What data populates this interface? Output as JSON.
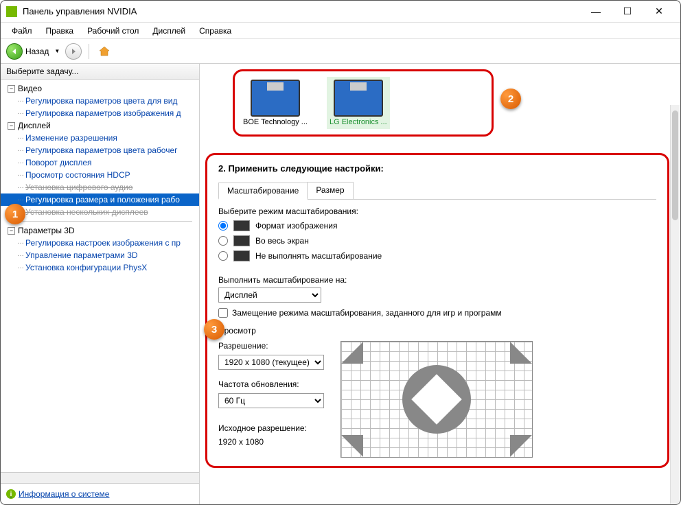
{
  "titlebar": {
    "title": "Панель управления NVIDIA"
  },
  "menubar": [
    "Файл",
    "Правка",
    "Рабочий стол",
    "Дисплей",
    "Справка"
  ],
  "toolbar": {
    "back_label": "Назад"
  },
  "sidebar": {
    "header": "Выберите задачу...",
    "groups": [
      {
        "label": "Видео",
        "children": [
          "Регулировка параметров цвета для вид",
          "Регулировка параметров изображения д"
        ]
      },
      {
        "label": "Дисплей",
        "children": [
          "Изменение разрешения",
          "Регулировка параметров цвета рабочег",
          "Поворот дисплея",
          "Просмотр состояния HDCP",
          "Установка цифрового аудио",
          "Регулировка размера и положения рабо",
          "Установка нескольких дисплеев"
        ],
        "selected": 5,
        "struck": [
          4,
          6
        ]
      },
      {
        "label": "Параметры 3D",
        "children": [
          "Регулировка настроек изображения с пр",
          "Управление параметрами 3D",
          "Установка конфигурации PhysX"
        ]
      }
    ],
    "info_link": "Информация о системе"
  },
  "displays": {
    "items": [
      {
        "name": "BOE Technology ...",
        "selected": false
      },
      {
        "name": "LG Electronics ...",
        "selected": true
      }
    ]
  },
  "settings": {
    "heading": "2. Применить следующие настройки:",
    "tabs": [
      "Масштабирование",
      "Размер"
    ],
    "active_tab": 0,
    "mode_label": "Выберите режим масштабирования:",
    "modes": [
      {
        "label": "Формат изображения",
        "checked": true
      },
      {
        "label": "Во весь экран",
        "checked": false
      },
      {
        "label": "Не выполнять масштабирование",
        "checked": false
      }
    ],
    "perform_on_label": "Выполнить масштабирование на:",
    "perform_on_value": "Дисплей",
    "override_label": "Замещение режима масштабирования, заданного для игр и программ",
    "preview_heading": "Просмотр",
    "resolution_label": "Разрешение:",
    "resolution_value": "1920 x 1080 (текущее)",
    "refresh_label": "Частота обновления:",
    "refresh_value": "60 Гц",
    "native_label": "Исходное разрешение:",
    "native_value": "1920 x 1080"
  },
  "markers": {
    "m1": "1",
    "m2": "2",
    "m3": "3"
  }
}
